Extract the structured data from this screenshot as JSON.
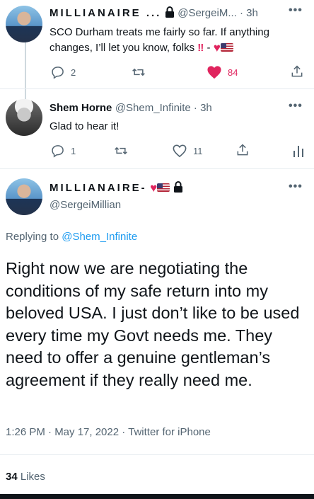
{
  "tweet1": {
    "author_name": "MILLIANAIRE ...",
    "handle_time": "@SergeiM... · 3h",
    "text_line1": "SCO Durham treats me fairly so far. If anything",
    "text_line2": "changes, I’ll let you know, folks",
    "replies": "2",
    "likes": "84"
  },
  "tweet2": {
    "author_name": "Shem Horne",
    "handle_time": "@Shem_Infinite · 3h",
    "text": "Glad to hear it!",
    "replies": "1",
    "likes": "11"
  },
  "main": {
    "author_name": "MILLIANAIRE-",
    "handle": "@SergeiMillian",
    "replying_prefix": "Replying to ",
    "replying_handle": "@Shem_Infinite",
    "text": "Right now we are negotiating the conditions of my safe return into my beloved USA. I just don’t like to be used every time my Govt needs me. They need to offer a genuine gentleman’s agreement if they really need me.",
    "timestamp": "1:26 PM · May 17, 2022 · Twitter for iPhone",
    "likes_count": "34",
    "likes_label": "Likes"
  },
  "colors": {
    "accent": "#1d9bf0",
    "like_red": "#e0245e"
  },
  "icons": [
    "reply-icon",
    "retweet-icon",
    "like-icon",
    "share-icon",
    "analytics-icon",
    "lock-icon",
    "more-icon"
  ]
}
